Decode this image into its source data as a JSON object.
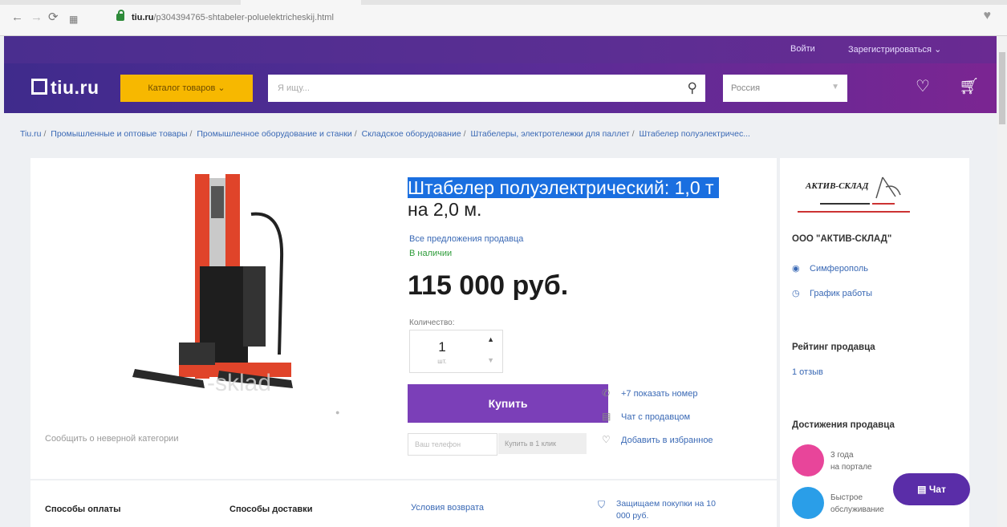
{
  "browser": {
    "url_host": "tiu.ru",
    "url_path": "/p304394765-shtabeler-poluelektricheskij.html"
  },
  "topnav": {
    "login": "Войти",
    "register": "Зарегистрироваться"
  },
  "header": {
    "logo": "tiu.ru",
    "catalog_button": "Каталог товаров",
    "search_placeholder": "Я ищу...",
    "region": "Россия"
  },
  "breadcrumb": [
    "Tiu.ru",
    "Промышленные и оптовые товары",
    "Промышленное оборудование и станки",
    "Складское оборудование",
    "Штабелеры, электротележки для паллет",
    "Штабелер полуэлектричес..."
  ],
  "product": {
    "title_highlighted": "Штабелер полуэлектрический: 1,0 т",
    "title_rest": "на 2,0 м.",
    "all_offers": "Все предложения продавца",
    "stock": "В наличии",
    "price": "115 000 руб.",
    "qty_label": "Количество:",
    "qty_value": "1",
    "qty_unit": "шт.",
    "buy_button": "Купить",
    "phone_placeholder": "Ваш телефон",
    "one_click": "Купить в 1 клик",
    "show_phone": "+7 показать номер",
    "chat_seller": "Чат с продавцом",
    "add_favorites": "Добавить в избранное",
    "image_watermark": "-sklad",
    "report": "Сообщить о неверной категории"
  },
  "info": {
    "payment_title": "Способы оплаты",
    "delivery_title": "Способы доставки",
    "return_link": "Условия возврата",
    "protect": "Защищаем покупки на 10 000 руб."
  },
  "seller": {
    "logo_text": "АКТИВ-СКЛАД",
    "name": "ООО \"АКТИВ-СКЛАД\"",
    "city": "Симферополь",
    "schedule": "График работы",
    "rating_title": "Рейтинг продавца",
    "reviews": "1 отзыв",
    "achievements_title": "Достижения продавца",
    "ach1_line1": "3 года",
    "ach1_line2": "на портале",
    "ach2_line1": "Быстрое",
    "ach2_line2": "обслуживание"
  },
  "chat_button": "Чат",
  "colors": {
    "header_start": "#3f2b8c",
    "header_end": "#7b2592",
    "catalog": "#f7b800",
    "buy": "#7b3fb8",
    "link": "#3a69b5",
    "selection": "#1a6fe0",
    "stock": "#2e9c3a"
  }
}
